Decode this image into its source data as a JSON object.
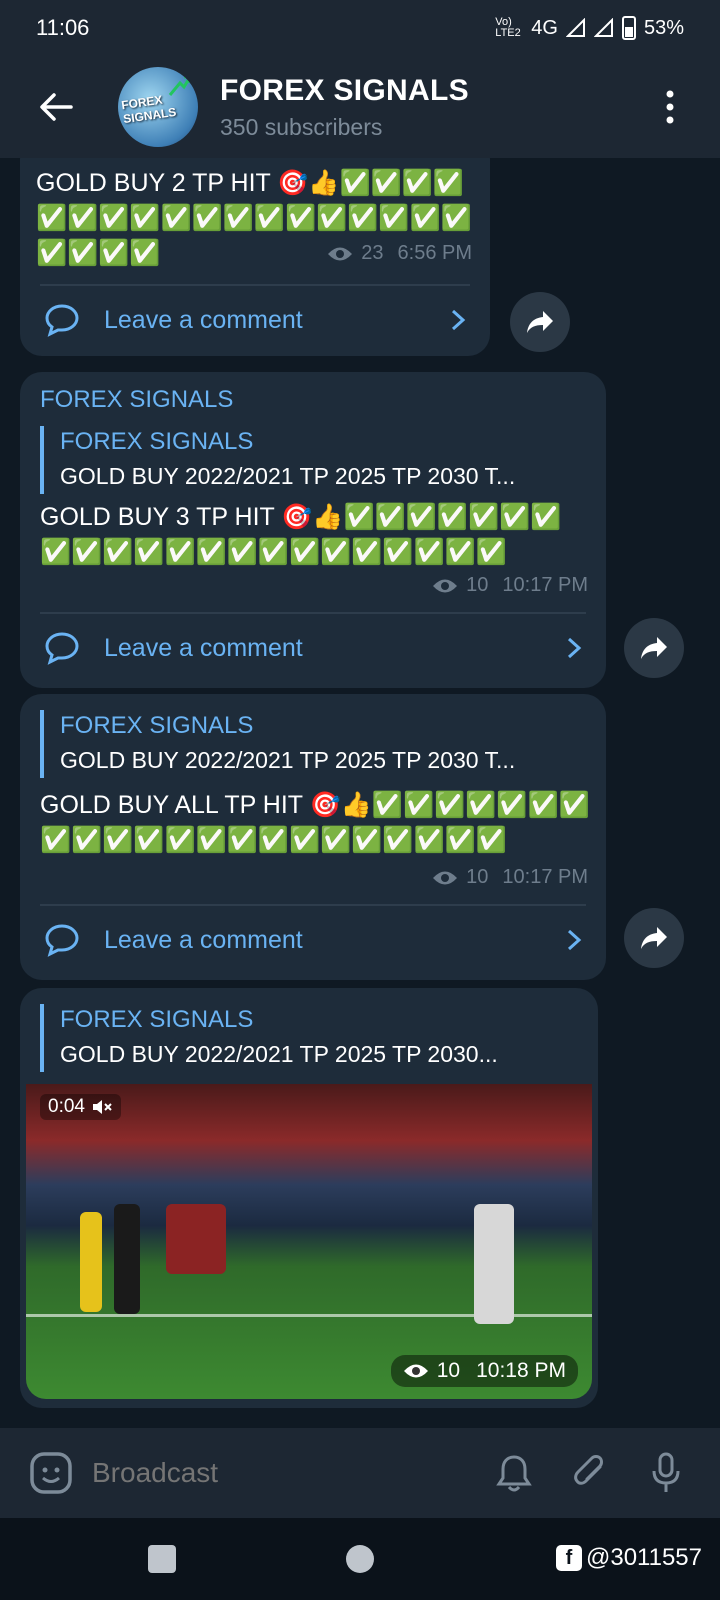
{
  "status_bar": {
    "time": "11:06",
    "network": "4G",
    "volte": "Vo) LTE2",
    "battery": "53%"
  },
  "header": {
    "title": "FOREX SIGNALS",
    "subtitle": "350 subscribers",
    "avatar_text": "FOREX SIGNALS"
  },
  "messages": [
    {
      "text": "GOLD BUY 2 TP HIT 🎯👍✅✅✅✅✅✅✅✅✅✅✅✅✅✅✅✅✅✅✅✅✅✅",
      "views": "23",
      "time": "6:56 PM",
      "comment_label": "Leave a comment"
    },
    {
      "author": "FOREX SIGNALS",
      "reply_author": "FOREX SIGNALS",
      "reply_text": "GOLD BUY 2022/2021  TP  2025 TP  2030 T...",
      "text": "GOLD BUY 3 TP HIT 🎯👍✅✅✅✅✅✅✅✅✅✅✅✅✅✅✅✅✅✅✅✅✅✅",
      "views": "10",
      "time": "10:17 PM",
      "comment_label": "Leave a comment"
    },
    {
      "reply_author": "FOREX SIGNALS",
      "reply_text": "GOLD BUY 2022/2021  TP  2025 TP  2030 T...",
      "text": "GOLD BUY ALL TP HIT 🎯👍✅✅✅✅✅✅✅✅✅✅✅✅✅✅✅✅✅✅✅✅✅✅",
      "views": "10",
      "time": "10:17 PM",
      "comment_label": "Leave a comment"
    },
    {
      "reply_author": "FOREX SIGNALS",
      "reply_text": "GOLD BUY 2022/2021  TP  2025 TP  2030...",
      "video_duration": "0:04",
      "views": "10",
      "time": "10:18 PM"
    }
  ],
  "input_bar": {
    "placeholder": "Broadcast"
  },
  "watermark": "@3011557",
  "colors": {
    "accent": "#6ab3f3",
    "bubble": "#1e2c3a",
    "header": "#1d2733",
    "background": "#0f1923"
  }
}
